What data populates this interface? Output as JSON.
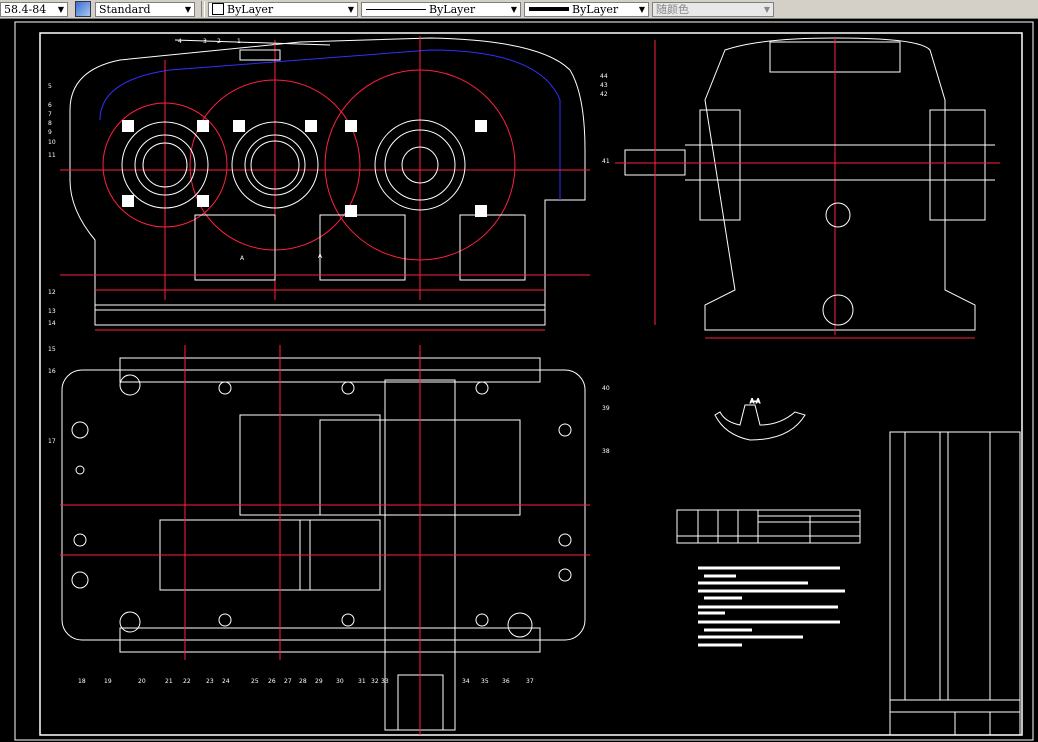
{
  "toolbar": {
    "dimstyle": "58.4-84",
    "textstyle": "Standard",
    "layer_color": "ByLayer",
    "linetype": "ByLayer",
    "lineweight": "ByLayer",
    "plotstyle": "随颜色"
  },
  "colors": {
    "background": "#000000",
    "outline": "#ffffff",
    "center": "#ff2040",
    "hidden": "#2020ff",
    "toolbar": "#d4d0c8"
  },
  "balloons": {
    "front_top": [
      "4",
      "3",
      "2",
      "1"
    ],
    "front_left": [
      "5",
      "6",
      "7",
      "8",
      "9",
      "10",
      "11",
      "12",
      "13",
      "14"
    ],
    "front_right": [
      "44",
      "43",
      "42"
    ],
    "side": [
      "41"
    ],
    "top_left": [
      "15",
      "16",
      "17"
    ],
    "top_right": [
      "40",
      "39",
      "38"
    ],
    "bottom": [
      "18",
      "19",
      "20",
      "21",
      "22",
      "23",
      "24",
      "25",
      "26",
      "27",
      "28",
      "29",
      "30",
      "31",
      "32",
      "33",
      "34",
      "35",
      "36",
      "37"
    ]
  },
  "section_label": "A-A",
  "section_marks": [
    "A",
    "A"
  ]
}
